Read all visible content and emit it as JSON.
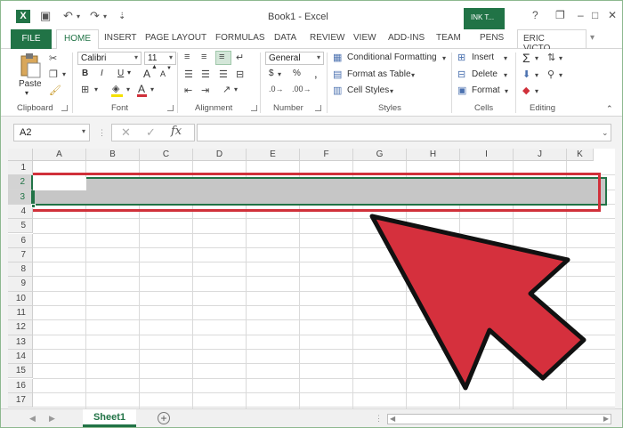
{
  "title_bar": {
    "title": "Book1 - Excel",
    "ink_tab": "INK T...",
    "help": "?",
    "restore": "❐",
    "minimize": "–",
    "maximize": "□",
    "close": "✕"
  },
  "ribbon_tabs": [
    "FILE",
    "HOME",
    "INSERT",
    "PAGE LAYOUT",
    "FORMULAS",
    "DATA",
    "REVIEW",
    "VIEW",
    "ADD-INS",
    "TEAM",
    "PENS"
  ],
  "user_name": "ERIC VICTO...",
  "clipboard": {
    "paste_label": "Paste",
    "group_label": "Clipboard"
  },
  "font": {
    "font_name": "Calibri",
    "font_size": "11",
    "bold": "B",
    "italic": "I",
    "underline": "U",
    "grow": "A",
    "shrink": "A",
    "color_glyph": "A",
    "group_label": "Font"
  },
  "alignment": {
    "group_label": "Alignment"
  },
  "number": {
    "format": "General",
    "dollar": "$",
    "percent": "%",
    "comma": ",",
    "group_label": "Number"
  },
  "styles": {
    "conditional": "Conditional Formatting",
    "format_table": "Format as Table",
    "cell_styles": "Cell Styles",
    "group_label": "Styles"
  },
  "cells": {
    "insert": "Insert",
    "delete": "Delete",
    "format": "Format",
    "group_label": "Cells"
  },
  "editing": {
    "sigma": "Σ",
    "group_label": "Editing"
  },
  "formula_bar": {
    "name_box": "A2",
    "fx": "fx",
    "cancel": "✕",
    "enter": "✓",
    "formula": ""
  },
  "columns": [
    "A",
    "B",
    "C",
    "D",
    "E",
    "F",
    "G",
    "H",
    "I",
    "J",
    "K"
  ],
  "rows": [
    "1",
    "2",
    "3",
    "4",
    "5",
    "6",
    "7",
    "8",
    "9",
    "10",
    "11",
    "12",
    "13",
    "14",
    "15",
    "16",
    "17"
  ],
  "selected_rows": [
    "2",
    "3"
  ],
  "sheet_tab": "Sheet1",
  "colors": {
    "excel_green": "#217346",
    "highlight_red": "#d0303a",
    "selection_gray": "#c6c6c6"
  },
  "icons": [
    "excel-logo-icon",
    "save-icon",
    "undo-icon",
    "redo-icon",
    "paste-icon",
    "cut-icon",
    "copy-icon",
    "format-painter-icon",
    "borders-icon",
    "fill-color-icon",
    "font-color-icon",
    "align-top-icon",
    "align-middle-icon",
    "align-bottom-icon",
    "wrap-text-icon",
    "orientation-icon",
    "merge-icon",
    "conditional-formatting-icon",
    "format-table-icon",
    "cell-styles-icon",
    "insert-cells-icon",
    "delete-cells-icon",
    "format-cells-icon",
    "autosum-icon",
    "sort-filter-icon",
    "fill-icon",
    "find-icon",
    "clear-icon",
    "big-red-arrow-icon"
  ]
}
